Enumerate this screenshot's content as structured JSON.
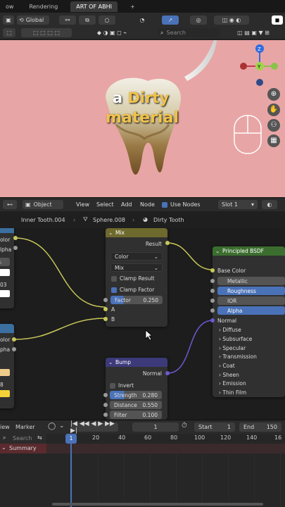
{
  "tabs": [
    {
      "label": "ow",
      "active": false
    },
    {
      "label": "Rendering",
      "active": false
    },
    {
      "label": "ART OF ABHI",
      "active": true
    },
    {
      "label": "+",
      "active": false
    }
  ],
  "viewport_header": {
    "orientation": "Global",
    "search_placeholder": "Search"
  },
  "overlay": {
    "line1_white": "a",
    "line1_yellow": "Dirty",
    "line2": "material"
  },
  "gizmo": {
    "x": "X",
    "y": "Y",
    "z": "Z"
  },
  "node_editor_header": {
    "object_mode": "Object",
    "menus": [
      "View",
      "Select",
      "Add",
      "Node"
    ],
    "use_nodes_label": "Use Nodes",
    "use_nodes_checked": true,
    "slot": "Slot 1"
  },
  "breadcrumb": {
    "item1": "Inner Tooth.004",
    "item2": "Sphere.008",
    "item3": "Dirty Tooth"
  },
  "left_partial_nodes": {
    "top": {
      "row1": "olor",
      "row2": "lpha",
      "row3": "L",
      "row4": "03"
    },
    "bottom": {
      "row1": "olor",
      "row2": "pha",
      "row3": "8"
    }
  },
  "mix_node": {
    "title": "Mix",
    "output": "Result",
    "data_type": "Color",
    "blend": "Mix",
    "clamp_result": "Clamp Result",
    "clamp_result_checked": false,
    "clamp_factor": "Clamp Factor",
    "clamp_factor_checked": true,
    "factor_label": "Factor",
    "factor_value": "0.250",
    "input_a": "A",
    "input_b": "B"
  },
  "bump_node": {
    "title": "Bump",
    "output": "Normal",
    "invert": "Invert",
    "invert_checked": false,
    "strength_label": "Strength",
    "strength_value": "0.280",
    "distance_label": "Distance",
    "distance_value": "0.550",
    "filter_label": "Filter",
    "filter_value": "0.100"
  },
  "bsdf_node": {
    "title": "Principled BSDF",
    "inputs": [
      "Base Color",
      "Metallic",
      "Roughness",
      "IOR",
      "Alpha",
      "Normal"
    ],
    "panels": [
      "Diffuse",
      "Subsurface",
      "Specular",
      "Transmission",
      "Coat",
      "Sheen",
      "Emission",
      "Thin Film"
    ]
  },
  "timeline": {
    "view": "iew",
    "marker": "Marker",
    "current_frame": "1",
    "start_label": "Start",
    "start_value": "1",
    "end_label": "End",
    "end_value": "150",
    "ruler": [
      "1",
      "20",
      "40",
      "60",
      "80",
      "100",
      "120",
      "140",
      "16"
    ],
    "search_placeholder": "Search",
    "summary": "Summary"
  },
  "colors": {
    "viewport_bg": "#e8a5a5",
    "mix_header": "#6e6a2e",
    "bump_header": "#3d3a7a",
    "bsdf_header": "#3b6e2e",
    "link_yellow": "#c8c85a",
    "link_purple": "#6a5ad0",
    "accent_blue": "#4a72b8"
  }
}
